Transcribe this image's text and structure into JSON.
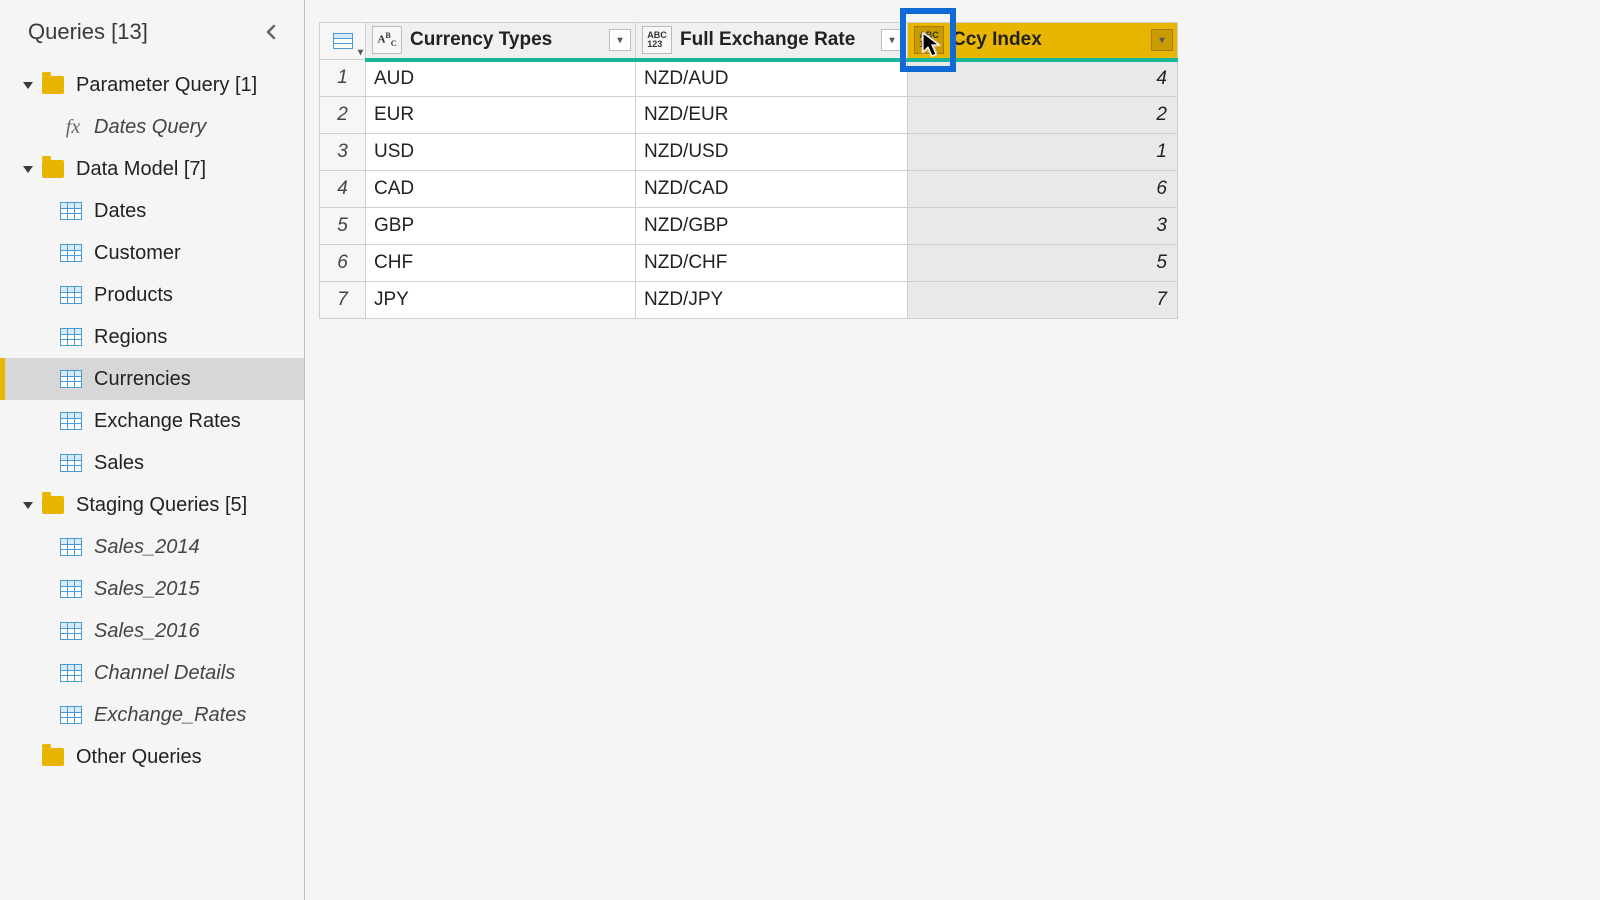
{
  "sidebar": {
    "title": "Queries [13]",
    "groups": [
      {
        "label": "Parameter Query [1]",
        "items": [
          {
            "label": "Dates Query",
            "icon": "fx",
            "italic": true
          }
        ]
      },
      {
        "label": "Data Model [7]",
        "items": [
          {
            "label": "Dates",
            "icon": "table"
          },
          {
            "label": "Customer",
            "icon": "table"
          },
          {
            "label": "Products",
            "icon": "table"
          },
          {
            "label": "Regions",
            "icon": "table"
          },
          {
            "label": "Currencies",
            "icon": "table",
            "selected": true
          },
          {
            "label": "Exchange Rates",
            "icon": "table"
          },
          {
            "label": "Sales",
            "icon": "table"
          }
        ]
      },
      {
        "label": "Staging Queries [5]",
        "items": [
          {
            "label": "Sales_2014",
            "icon": "table",
            "italic": true
          },
          {
            "label": "Sales_2015",
            "icon": "table",
            "italic": true
          },
          {
            "label": "Sales_2016",
            "icon": "table",
            "italic": true
          },
          {
            "label": "Channel Details",
            "icon": "table",
            "italic": true
          },
          {
            "label": "Exchange_Rates",
            "icon": "table",
            "italic": true
          }
        ]
      }
    ],
    "loose": {
      "label": "Other Queries"
    }
  },
  "table": {
    "columns": [
      {
        "name": "Currency Types",
        "type": "text"
      },
      {
        "name": "Full Exchange Rate",
        "type": "any"
      },
      {
        "name": "Ccy Index",
        "type": "any",
        "selected": true
      }
    ],
    "rows": [
      {
        "n": "1",
        "c1": "AUD",
        "c2": "NZD/AUD",
        "c3": "4"
      },
      {
        "n": "2",
        "c1": "EUR",
        "c2": "NZD/EUR",
        "c3": "2"
      },
      {
        "n": "3",
        "c1": "USD",
        "c2": "NZD/USD",
        "c3": "1"
      },
      {
        "n": "4",
        "c1": "CAD",
        "c2": "NZD/CAD",
        "c3": "6"
      },
      {
        "n": "5",
        "c1": "GBP",
        "c2": "NZD/GBP",
        "c3": "3"
      },
      {
        "n": "6",
        "c1": "CHF",
        "c2": "NZD/CHF",
        "c3": "5"
      },
      {
        "n": "7",
        "c1": "JPY",
        "c2": "NZD/JPY",
        "c3": "7"
      }
    ]
  },
  "type_badges": {
    "text_top": "A",
    "text_mid": "B",
    "text_bot": "C",
    "any_top": "ABC",
    "any_bot": "123"
  }
}
